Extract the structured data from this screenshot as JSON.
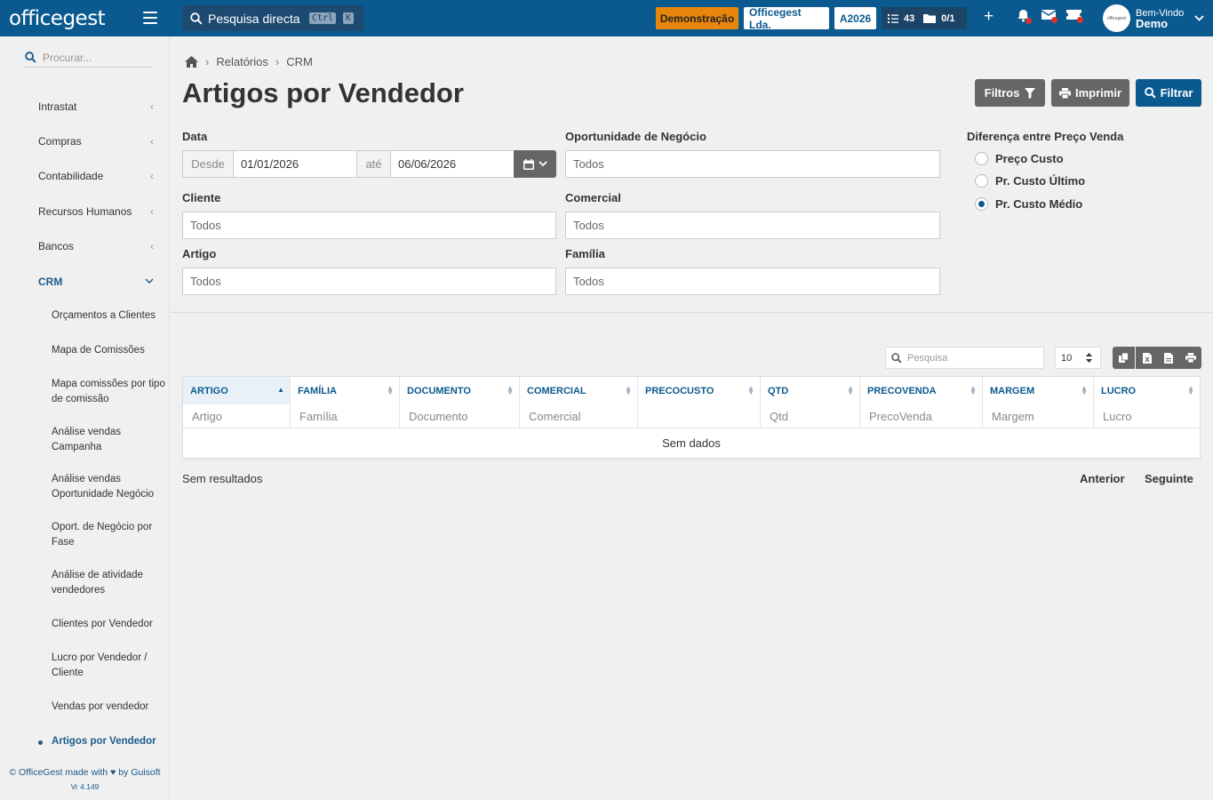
{
  "topbar": {
    "logo": "officegest",
    "search_label": "Pesquisa directa",
    "shortcut_ctrl": "Ctrl",
    "shortcut_k": "K",
    "demo_badge": "Demonstração",
    "company": "Officegest Lda.",
    "year": "A2026",
    "tasks_count": "43",
    "folders_count": "0/1",
    "welcome": "Bem-Vindo",
    "user": "Demo",
    "avatar_text": "officegest"
  },
  "sidebar": {
    "search_placeholder": "Procurar...",
    "items": [
      {
        "label": "Intrastat"
      },
      {
        "label": "Compras"
      },
      {
        "label": "Contabilidade"
      },
      {
        "label": "Recursos Humanos"
      },
      {
        "label": "Bancos"
      },
      {
        "label": "CRM"
      }
    ],
    "sub_items": [
      {
        "label": "Orçamentos a Clientes"
      },
      {
        "label": "Mapa de Comissões"
      },
      {
        "label": "Mapa comissões por tipo de comissão"
      },
      {
        "label": "Análise vendas Campanha"
      },
      {
        "label": "Análise vendas Oportunidade Negócio"
      },
      {
        "label": "Oport. de Negócio por Fase"
      },
      {
        "label": "Análise de atividade vendedores"
      },
      {
        "label": "Clientes por Vendedor"
      },
      {
        "label": "Lucro por Vendedor / Cliente"
      },
      {
        "label": "Vendas por vendedor"
      },
      {
        "label": "Artigos por Vendedor"
      }
    ],
    "footer_line1": "© OfficeGest made with ♥ by Guisoft",
    "footer_version": "Vr 4.149"
  },
  "breadcrumb": [
    "Relatórios",
    "CRM"
  ],
  "page_title": "Artigos por Vendedor",
  "actions": {
    "filters": "Filtros",
    "print": "Imprimir",
    "filter": "Filtrar"
  },
  "form": {
    "date_label": "Data",
    "from_label": "Desde",
    "from_value": "01/01/2026",
    "to_label": "até",
    "to_value": "06/06/2026",
    "opportunity_label": "Oportunidade de Negócio",
    "opportunity_value": "Todos",
    "client_label": "Cliente",
    "client_value": "Todos",
    "commercial_label": "Comercial",
    "commercial_value": "Todos",
    "article_label": "Artigo",
    "article_value": "Todos",
    "family_label": "Família",
    "family_value": "Todos",
    "price_diff_label": "Diferença entre Preço Venda",
    "options": [
      "Preço Custo",
      "Pr. Custo Último",
      "Pr. Custo Médio"
    ],
    "selected_option": "Pr. Custo Médio"
  },
  "table": {
    "search_placeholder": "Pesquisa",
    "page_size": "10",
    "columns": [
      "ARTIGO",
      "FAMÍLIA",
      "DOCUMENTO",
      "COMERCIAL",
      "PRECOCUSTO",
      "QTD",
      "PRECOVENDA",
      "MARGEM",
      "LUCRO"
    ],
    "filters": [
      "Artigo",
      "Família",
      "Documento",
      "Comercial",
      "",
      "Qtd",
      "PrecoVenda",
      "Margem",
      "Lucro"
    ],
    "empty": "Sem dados",
    "results": "Sem resultados",
    "prev": "Anterior",
    "next": "Seguinte"
  },
  "colors": {
    "brand": "#0b5a8f",
    "demo_badge": "#e8860c",
    "gray_button": "#666666"
  }
}
